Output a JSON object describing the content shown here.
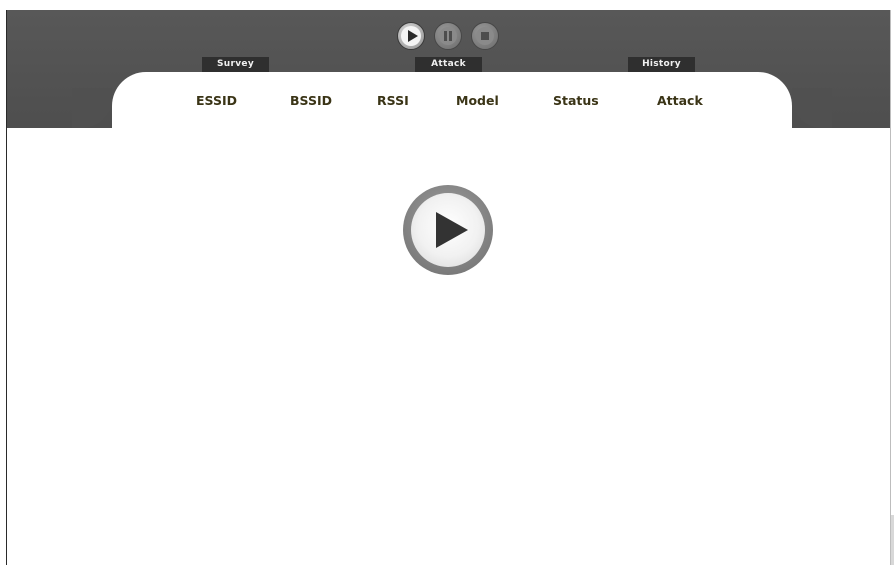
{
  "toolbar": {
    "play_icon": "play-icon",
    "pause_icon": "pause-icon",
    "stop_icon": "stop-icon"
  },
  "tabs": [
    {
      "label": "Survey"
    },
    {
      "label": "Attack"
    },
    {
      "label": "History"
    }
  ],
  "table": {
    "columns": [
      "ESSID",
      "BSSID",
      "RSSI",
      "Model",
      "Status",
      "Attack"
    ],
    "rows": []
  },
  "main": {
    "start_icon": "play-icon"
  },
  "colors": {
    "header_bg": "#535353",
    "tab_bg": "#2f2f2f",
    "column_text": "#3a3416"
  }
}
